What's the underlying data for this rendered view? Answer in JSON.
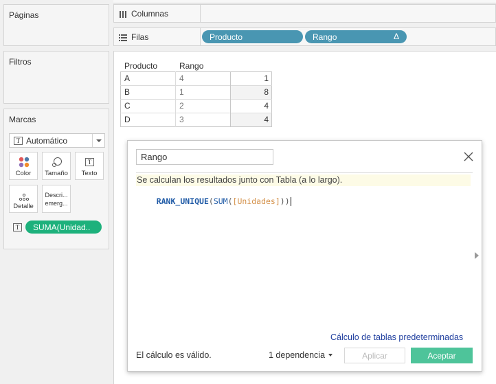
{
  "left_panels": {
    "pages": {
      "title": "Páginas"
    },
    "filters": {
      "title": "Filtros"
    },
    "marks": {
      "title": "Marcas",
      "type_selected": "Automático",
      "buttons": {
        "color": "Color",
        "size": "Tamaño",
        "text": "Texto",
        "detail": "Detalle",
        "description_line1": "Descri...",
        "description_line2": "emerg..."
      },
      "field_pill": "SUMA(Unidad.."
    }
  },
  "shelves": {
    "columns": {
      "label": "Columnas"
    },
    "rows": {
      "label": "Filas",
      "pills": [
        {
          "label": "Producto"
        },
        {
          "label": "Rango",
          "delta": "Δ"
        }
      ]
    }
  },
  "table": {
    "headers": [
      "Producto",
      "Rango"
    ],
    "rows": [
      {
        "product": "A",
        "rank": "4",
        "value": "1"
      },
      {
        "product": "B",
        "rank": "1",
        "value": "8"
      },
      {
        "product": "C",
        "rank": "2",
        "value": "4"
      },
      {
        "product": "D",
        "rank": "3",
        "value": "4"
      }
    ]
  },
  "calc_dialog": {
    "name": "Rango",
    "info_text": "Se calculan los resultados junto con Tabla (a lo largo).",
    "formula": {
      "func_outer": "RANK_UNIQUE",
      "paren_open": "(",
      "func_inner": "SUM",
      "paren_open2": "(",
      "field": "[Unidades]",
      "parens_close": "))"
    },
    "default_table_calc_link": "Cálculo de tablas predeterminadas",
    "status": "El cálculo es válido.",
    "dependencies": "1 dependencia",
    "apply_button": "Aplicar",
    "ok_button": "Aceptar"
  },
  "colors": {
    "pill_blue": "#4996b2",
    "pill_green": "#1db17c",
    "accept_green": "#4ec49a",
    "link_blue": "#1f3e9e",
    "formula_func": "#1f5aa6",
    "formula_field": "#d4914a",
    "info_bg": "#fdfbe6"
  }
}
